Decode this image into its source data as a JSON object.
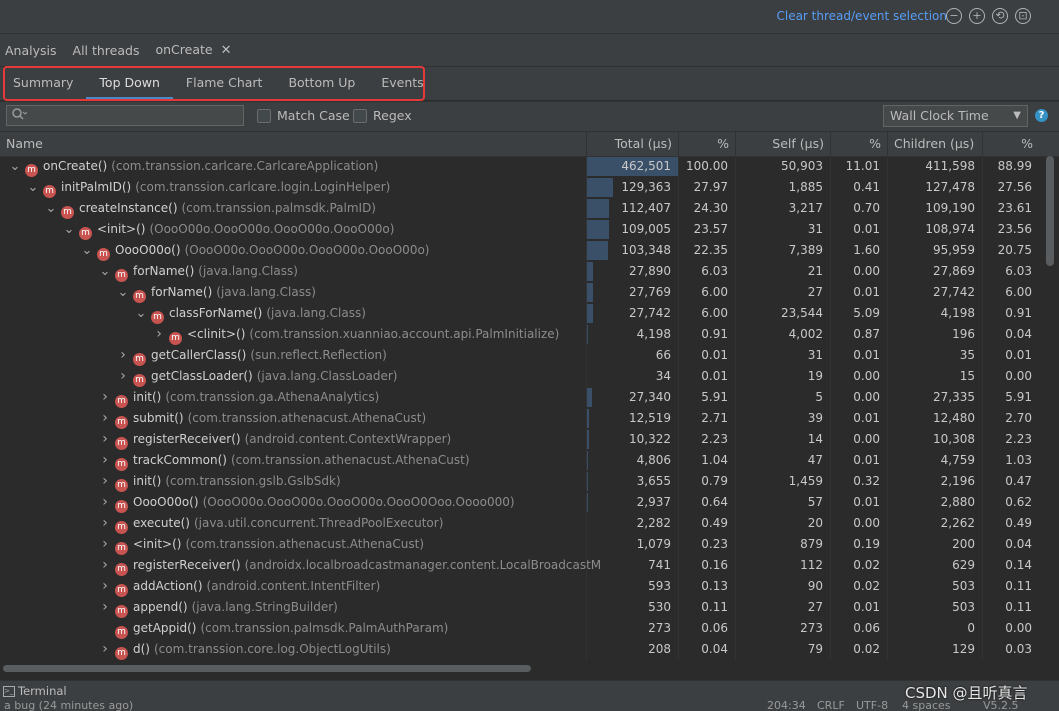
{
  "toolbar": {
    "clear_link": "Clear thread/event selection",
    "icons": [
      "zoom-out-icon",
      "zoom-in-icon",
      "reset-zoom-icon",
      "fit-icon"
    ]
  },
  "tabs": {
    "analysis": "Analysis",
    "all_threads": "All threads",
    "oncreate": "onCreate",
    "close": "✕"
  },
  "subtabs": [
    "Summary",
    "Top Down",
    "Flame Chart",
    "Bottom Up",
    "Events"
  ],
  "subtabs_active": "Top Down",
  "filter": {
    "search_placeholder": "",
    "match_case": "Match Case",
    "regex": "Regex",
    "clock_select": "Wall Clock Time"
  },
  "columns": {
    "name": "Name",
    "total": "Total (μs)",
    "total_pct": "%",
    "self": "Self (μs)",
    "self_pct": "%",
    "children": "Children (μs)",
    "children_pct": "%"
  },
  "rows": [
    {
      "indent": 0,
      "toggle": "expanded",
      "name": "onCreate()",
      "cls": "(com.transsion.carlcare.CarlcareApplication)",
      "total": "462,501",
      "tpct": "100.00",
      "self": "50,903",
      "spct": "11.01",
      "children": "411,598",
      "cpct": "88.99",
      "bar": 1.0
    },
    {
      "indent": 1,
      "toggle": "expanded",
      "name": "initPalmID()",
      "cls": "(com.transsion.carlcare.login.LoginHelper)",
      "total": "129,363",
      "tpct": "27.97",
      "self": "1,885",
      "spct": "0.41",
      "children": "127,478",
      "cpct": "27.56",
      "bar": 0.28
    },
    {
      "indent": 2,
      "toggle": "expanded",
      "name": "createInstance()",
      "cls": "(com.transsion.palmsdk.PalmID)",
      "total": "112,407",
      "tpct": "24.30",
      "self": "3,217",
      "spct": "0.70",
      "children": "109,190",
      "cpct": "23.61",
      "bar": 0.243
    },
    {
      "indent": 3,
      "toggle": "expanded",
      "name": "<init>()",
      "cls": "(OooO00o.OooO00o.OooO00o.OooO00o)",
      "total": "109,005",
      "tpct": "23.57",
      "self": "31",
      "spct": "0.01",
      "children": "108,974",
      "cpct": "23.56",
      "bar": 0.236
    },
    {
      "indent": 4,
      "toggle": "expanded",
      "name": "OooO00o()",
      "cls": "(OooO00o.OooO00o.OooO00o.OooO00o)",
      "total": "103,348",
      "tpct": "22.35",
      "self": "7,389",
      "spct": "1.60",
      "children": "95,959",
      "cpct": "20.75",
      "bar": 0.224
    },
    {
      "indent": 5,
      "toggle": "expanded",
      "name": "forName()",
      "cls": "(java.lang.Class)",
      "total": "27,890",
      "tpct": "6.03",
      "self": "21",
      "spct": "0.00",
      "children": "27,869",
      "cpct": "6.03",
      "bar": 0.06
    },
    {
      "indent": 6,
      "toggle": "expanded",
      "name": "forName()",
      "cls": "(java.lang.Class)",
      "total": "27,769",
      "tpct": "6.00",
      "self": "27",
      "spct": "0.01",
      "children": "27,742",
      "cpct": "6.00",
      "bar": 0.06
    },
    {
      "indent": 7,
      "toggle": "expanded",
      "name": "classForName()",
      "cls": "(java.lang.Class)",
      "total": "27,742",
      "tpct": "6.00",
      "self": "23,544",
      "spct": "5.09",
      "children": "4,198",
      "cpct": "0.91",
      "bar": 0.06
    },
    {
      "indent": 8,
      "toggle": "collapsed",
      "name": "<clinit>()",
      "cls": "(com.transsion.xuanniao.account.api.PalmInitialize)",
      "total": "4,198",
      "tpct": "0.91",
      "self": "4,002",
      "spct": "0.87",
      "children": "196",
      "cpct": "0.04",
      "bar": 0.009
    },
    {
      "indent": 6,
      "toggle": "collapsed",
      "name": "getCallerClass()",
      "cls": "(sun.reflect.Reflection)",
      "total": "66",
      "tpct": "0.01",
      "self": "31",
      "spct": "0.01",
      "children": "35",
      "cpct": "0.01",
      "bar": 0
    },
    {
      "indent": 6,
      "toggle": "collapsed",
      "name": "getClassLoader()",
      "cls": "(java.lang.ClassLoader)",
      "total": "34",
      "tpct": "0.01",
      "self": "19",
      "spct": "0.00",
      "children": "15",
      "cpct": "0.00",
      "bar": 0
    },
    {
      "indent": 5,
      "toggle": "collapsed",
      "name": "init()",
      "cls": "(com.transsion.ga.AthenaAnalytics)",
      "total": "27,340",
      "tpct": "5.91",
      "self": "5",
      "spct": "0.00",
      "children": "27,335",
      "cpct": "5.91",
      "bar": 0.059
    },
    {
      "indent": 5,
      "toggle": "collapsed",
      "name": "submit()",
      "cls": "(com.transsion.athenacust.AthenaCust)",
      "total": "12,519",
      "tpct": "2.71",
      "self": "39",
      "spct": "0.01",
      "children": "12,480",
      "cpct": "2.70",
      "bar": 0.027
    },
    {
      "indent": 5,
      "toggle": "collapsed",
      "name": "registerReceiver()",
      "cls": "(android.content.ContextWrapper)",
      "total": "10,322",
      "tpct": "2.23",
      "self": "14",
      "spct": "0.00",
      "children": "10,308",
      "cpct": "2.23",
      "bar": 0.022
    },
    {
      "indent": 5,
      "toggle": "collapsed",
      "name": "trackCommon()",
      "cls": "(com.transsion.athenacust.AthenaCust)",
      "total": "4,806",
      "tpct": "1.04",
      "self": "47",
      "spct": "0.01",
      "children": "4,759",
      "cpct": "1.03",
      "bar": 0.01
    },
    {
      "indent": 5,
      "toggle": "collapsed",
      "name": "init()",
      "cls": "(com.transsion.gslb.GslbSdk)",
      "total": "3,655",
      "tpct": "0.79",
      "self": "1,459",
      "spct": "0.32",
      "children": "2,196",
      "cpct": "0.47",
      "bar": 0.008
    },
    {
      "indent": 5,
      "toggle": "collapsed",
      "name": "OooO00o()",
      "cls": "(OooO00o.OooO00o.OooO00o.OooO0Ooo.Oooo000)",
      "total": "2,937",
      "tpct": "0.64",
      "self": "57",
      "spct": "0.01",
      "children": "2,880",
      "cpct": "0.62",
      "bar": 0.006
    },
    {
      "indent": 5,
      "toggle": "collapsed",
      "name": "execute()",
      "cls": "(java.util.concurrent.ThreadPoolExecutor)",
      "total": "2,282",
      "tpct": "0.49",
      "self": "20",
      "spct": "0.00",
      "children": "2,262",
      "cpct": "0.49",
      "bar": 0.005
    },
    {
      "indent": 5,
      "toggle": "collapsed",
      "name": "<init>()",
      "cls": "(com.transsion.athenacust.AthenaCust)",
      "total": "1,079",
      "tpct": "0.23",
      "self": "879",
      "spct": "0.19",
      "children": "200",
      "cpct": "0.04",
      "bar": 0.002
    },
    {
      "indent": 5,
      "toggle": "collapsed",
      "name": "registerReceiver()",
      "cls": "(androidx.localbroadcastmanager.content.LocalBroadcastM",
      "total": "741",
      "tpct": "0.16",
      "self": "112",
      "spct": "0.02",
      "children": "629",
      "cpct": "0.14",
      "bar": 0
    },
    {
      "indent": 5,
      "toggle": "collapsed",
      "name": "addAction()",
      "cls": "(android.content.IntentFilter)",
      "total": "593",
      "tpct": "0.13",
      "self": "90",
      "spct": "0.02",
      "children": "503",
      "cpct": "0.11",
      "bar": 0
    },
    {
      "indent": 5,
      "toggle": "collapsed",
      "name": "append()",
      "cls": "(java.lang.StringBuilder)",
      "total": "530",
      "tpct": "0.11",
      "self": "27",
      "spct": "0.01",
      "children": "503",
      "cpct": "0.11",
      "bar": 0
    },
    {
      "indent": 5,
      "toggle": "none",
      "name": "getAppid()",
      "cls": "(com.transsion.palmsdk.PalmAuthParam)",
      "total": "273",
      "tpct": "0.06",
      "self": "273",
      "spct": "0.06",
      "children": "0",
      "cpct": "0.00",
      "bar": 0
    },
    {
      "indent": 5,
      "toggle": "collapsed",
      "name": "d()",
      "cls": "(com.transsion.core.log.ObjectLogUtils)",
      "total": "208",
      "tpct": "0.04",
      "self": "79",
      "spct": "0.02",
      "children": "129",
      "cpct": "0.03",
      "bar": 0
    }
  ],
  "bottom": {
    "terminal": "Terminal",
    "status_left": "a bug (24 minutes ago)",
    "status_pos": "204:34",
    "status_crlf": "CRLF",
    "status_enc": "UTF-8",
    "status_indent": "4 spaces",
    "status_ver": "V5.2.5"
  },
  "watermark": "CSDN @且听真言"
}
